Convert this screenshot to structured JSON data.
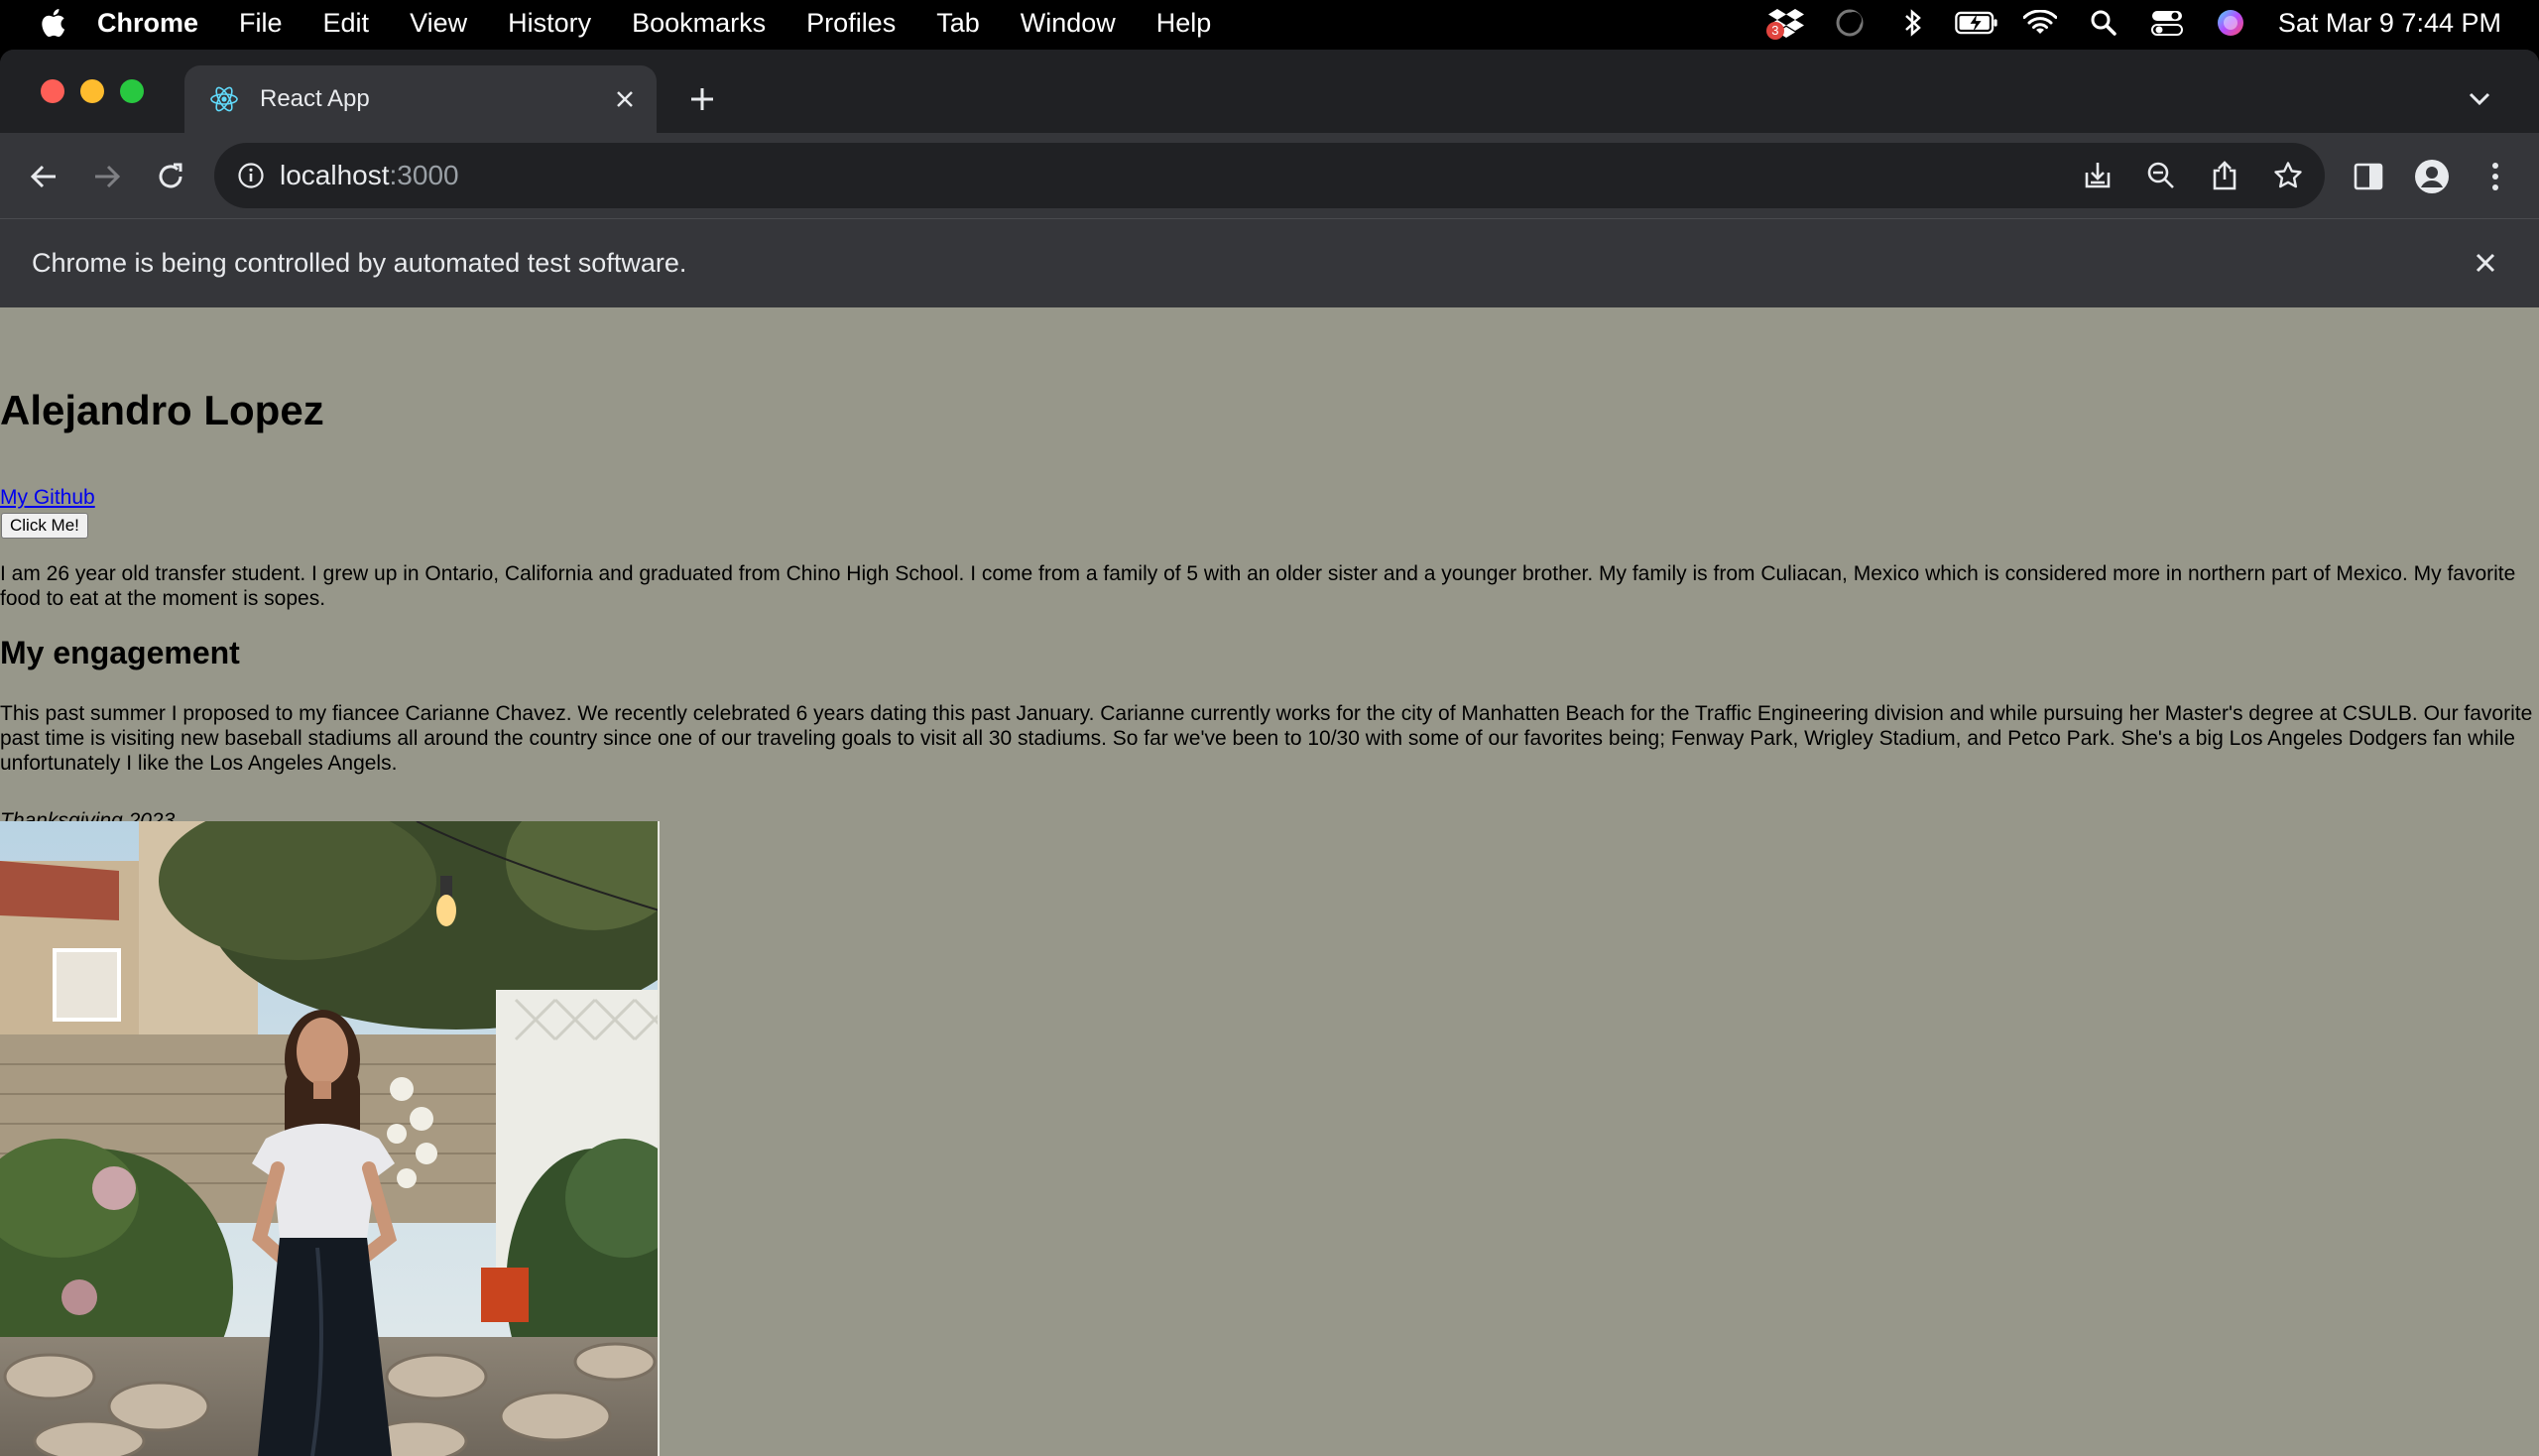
{
  "menubar": {
    "app_name": "Chrome",
    "items": [
      "File",
      "Edit",
      "View",
      "History",
      "Bookmarks",
      "Profiles",
      "Tab",
      "Window",
      "Help"
    ],
    "clock": "Sat Mar 9  7:44 PM",
    "dropbox_badge": "3"
  },
  "browser": {
    "tab_title": "React App",
    "url_host": "localhost",
    "url_port": ":3000",
    "infobar_message": "Chrome is being controlled by automated test software."
  },
  "page": {
    "name": "Alejandro Lopez",
    "github_link": "My Github",
    "button_label": "Click Me!",
    "bio": "I am 26 year old transfer student. I grew up in Ontario, California and graduated from Chino High School. I come from a family of 5 with an older sister and a younger brother. My family is from Culiacan, Mexico which is considered more in northern part of Mexico. My favorite food to eat at the moment is sopes.",
    "engagement_heading": "My engagement",
    "engagement_text": "This past summer I proposed to my fiancee Carianne Chavez. We recently celebrated 6 years dating this past January. Carianne currently works for the city of Manhatten Beach for the Traffic Engineering division and while pursuing her Master's degree at CSULB. Our favorite past time is visiting new baseball stadiums all around the country since one of our traveling goals to visit all 30 stadiums. So far we've been to 10/30 with some of our favorites being; Fenway Park, Wrigley Stadium, and Petco Park. She's a big Los Angeles Dodgers fan while unfortunately I like the Los Angeles Angels.",
    "photo_caption": "Thanksgiving 2023"
  }
}
